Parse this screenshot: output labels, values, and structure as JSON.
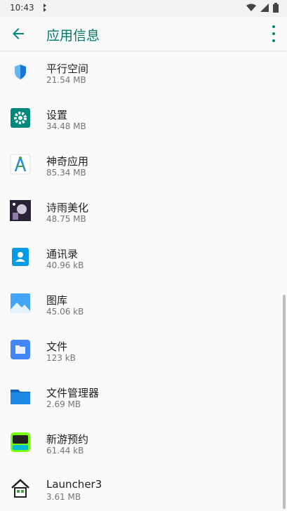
{
  "status": {
    "time": "10:43"
  },
  "app_bar": {
    "title": "应用信息"
  },
  "apps": [
    {
      "name": "平行空间",
      "size": "21.54 MB",
      "icon": "parallel-space-icon"
    },
    {
      "name": "设置",
      "size": "34.48 MB",
      "icon": "settings-gear-icon"
    },
    {
      "name": "神奇应用",
      "size": "85.34 MB",
      "icon": "magic-app-icon"
    },
    {
      "name": "诗雨美化",
      "size": "48.75 MB",
      "icon": "shiyu-beautify-icon"
    },
    {
      "name": "通讯录",
      "size": "40.96 kB",
      "icon": "contacts-icon"
    },
    {
      "name": "图库",
      "size": "45.06 kB",
      "icon": "gallery-icon"
    },
    {
      "name": "文件",
      "size": "123 kB",
      "icon": "files-icon"
    },
    {
      "name": "文件管理器",
      "size": "2.69 MB",
      "icon": "file-manager-icon"
    },
    {
      "name": "新游预约",
      "size": "61.44 kB",
      "icon": "new-game-reservation-icon"
    },
    {
      "name": "Launcher3",
      "size": "3.61 MB",
      "icon": "launcher-home-icon"
    }
  ],
  "colors": {
    "accent": "#00897b",
    "title": "#00796b"
  }
}
